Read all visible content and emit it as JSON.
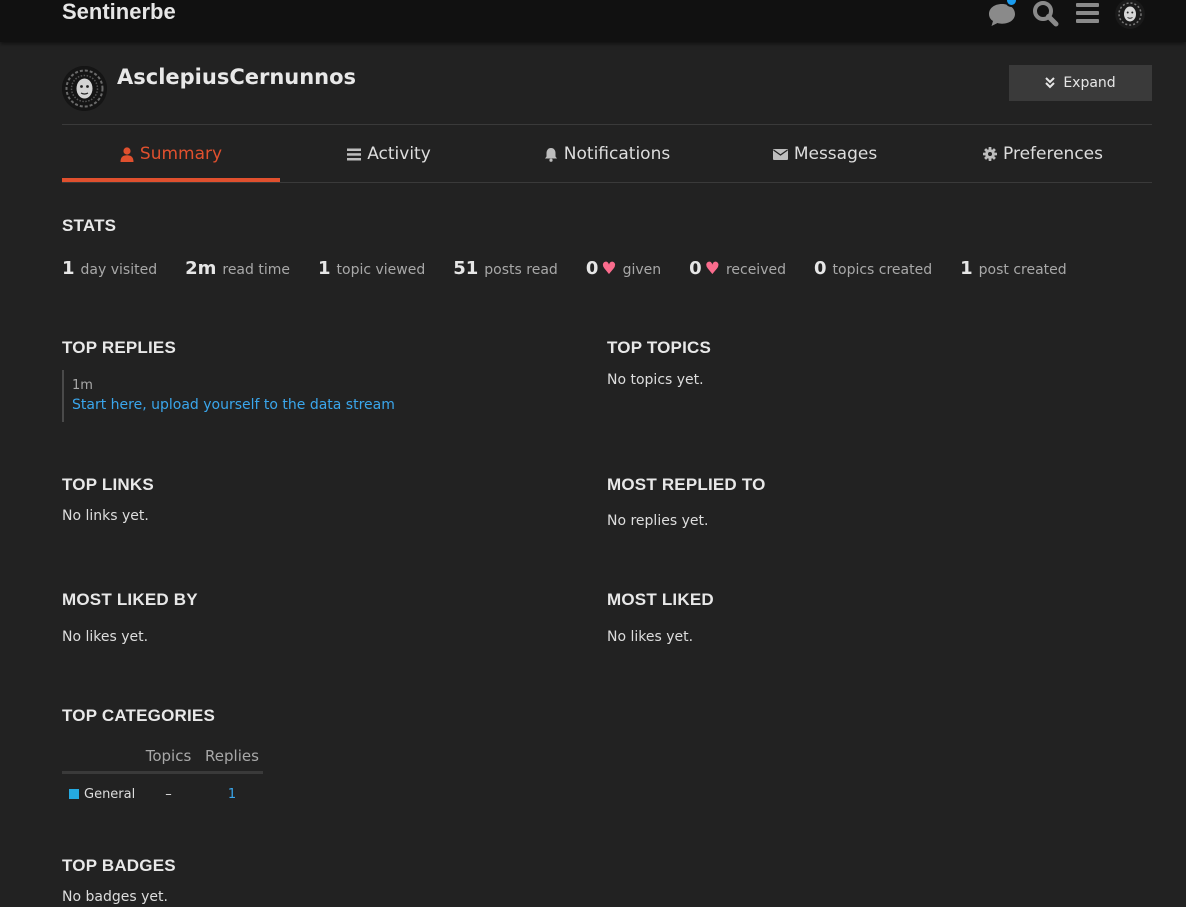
{
  "header": {
    "site_title": "Sentinerbe",
    "icons": [
      "chat-icon",
      "search-icon",
      "hamburger-menu-icon",
      "user-avatar"
    ],
    "notification_color": "#1a9cf0"
  },
  "profile": {
    "username": "AsclepiusCernunnos",
    "expand_label": "Expand"
  },
  "nav": {
    "tabs": [
      {
        "label": "Summary",
        "icon": "user-icon",
        "active": true
      },
      {
        "label": "Activity",
        "icon": "list-icon"
      },
      {
        "label": "Notifications",
        "icon": "bell-icon"
      },
      {
        "label": "Messages",
        "icon": "envelope-icon"
      },
      {
        "label": "Preferences",
        "icon": "gear-icon"
      }
    ],
    "accent": "#e0502e"
  },
  "stats": {
    "heading": "STATS",
    "items": [
      {
        "value": "1",
        "label": "day visited"
      },
      {
        "value": "2m",
        "label": "read time"
      },
      {
        "value": "1",
        "label": "topic viewed"
      },
      {
        "value": "51",
        "label": "posts read"
      },
      {
        "value": "0",
        "label": "given",
        "heart": true
      },
      {
        "value": "0",
        "label": "received",
        "heart": true
      },
      {
        "value": "0",
        "label": "topics created"
      },
      {
        "value": "1",
        "label": "post created"
      }
    ]
  },
  "sections": {
    "top_replies": {
      "heading": "TOP REPLIES",
      "time": "1m",
      "link": "Start here, upload yourself to the data stream"
    },
    "top_topics": {
      "heading": "TOP TOPICS",
      "empty": "No topics yet."
    },
    "top_links": {
      "heading": "TOP LINKS",
      "empty": "No links yet."
    },
    "most_replied_to": {
      "heading": "MOST REPLIED TO",
      "empty": "No replies yet."
    },
    "most_liked_by": {
      "heading": "MOST LIKED BY",
      "empty": "No likes yet."
    },
    "most_liked": {
      "heading": "MOST LIKED",
      "empty": "No likes yet."
    },
    "top_categories": {
      "heading": "TOP CATEGORIES",
      "columns": [
        "Topics",
        "Replies"
      ],
      "rows": [
        {
          "name": "General",
          "color": "#25aae1",
          "topics": "–",
          "replies": "1"
        }
      ]
    },
    "top_badges": {
      "heading": "TOP BADGES",
      "empty": "No badges yet."
    }
  }
}
